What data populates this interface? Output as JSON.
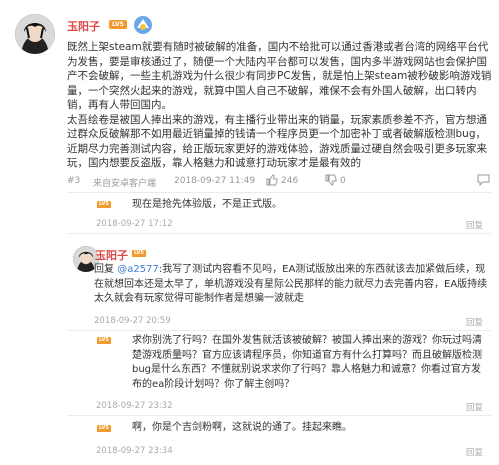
{
  "post": {
    "username": "玉阳子",
    "level": "LV5",
    "paragraph1": "既然上架steam就要有随时被破解的准备，国内不给批可以通过香港或者台湾的网络平台代为发售，要是审核通过了，随便一个大陆内平台都可以发售，国内多半游戏网站也会保护国产不会破解，一些主机游戏为什么很少有同步PC发售，就是怕上架steam被秒破影响游戏销量，一个突然火起来的游戏，就算中国人自己不破解，难保不会有外国人破解，出口转内销，再有人带回国内。",
    "paragraph2": "太吾绘卷是被国人捧出来的游戏，有主播行业带出来的销量，玩家素质参差不齐，官方想通过群众反破解那不如用最近销量掉的钱请一个程序员更一个加密补丁或者破解版检测bug，近期尽力完善测试内容，给正版玩家更好的游戏体验，游戏质量过硬自然会吸引更多玩家来玩，国内想要反盗版，靠人格魅力和诚意打动玩家才是最有效的",
    "floor": "#3",
    "device": "来自安卓客户端",
    "timestamp": "2018-09-27 11:49",
    "likes": "246",
    "dislikes": "0"
  },
  "replies": [
    {
      "text": "现在是抢先体验版，不是正式版。",
      "time": "2018-09-27 17:12",
      "action": "回复"
    },
    {
      "text": "求你别洗了行吗？在国外发售就活该被破解？被国人捧出来的游戏？你玩过吗清楚游戏质量吗？官方应该请程序员，你知道官方有什么打算吗？而且破解版检测bug是什么东西？不懂就别说求求你了行吗？靠人格魅力和诚意？你看过官方发布的ea阶段计划吗？你了解主创吗？",
      "time": "2018-09-27 23:32",
      "action": "回复"
    },
    {
      "text": "啊，你是个吉剑粉啊，这就说的通了。挂起来瞧。",
      "time": "2018-09-27 23:34",
      "action": "回复"
    }
  ],
  "sub_reply": {
    "username": "玉阳子",
    "level": "LV5",
    "prefix": "回复",
    "mention": "@a2577",
    "text": ":我写了测试内容看不见吗，EA测试版放出来的东西就该去加紧做后续，现在就想回本还是太早了，单机游戏没有星际公民那样的能力就尽力去完善内容，EA版持续太久就会有玩家觉得可能制作者是想骗一波就走",
    "time": "2018-09-27 20:59",
    "action": "回复"
  },
  "icons": [
    "avatar",
    "badge-icon",
    "thumbs-up-icon",
    "thumbs-down-icon",
    "chat-icon",
    "reply-icon"
  ],
  "colors": {
    "username": "#e04848",
    "level_badge": "#f29a2e",
    "meta": "#999999",
    "mention": "#3b7fd4"
  }
}
